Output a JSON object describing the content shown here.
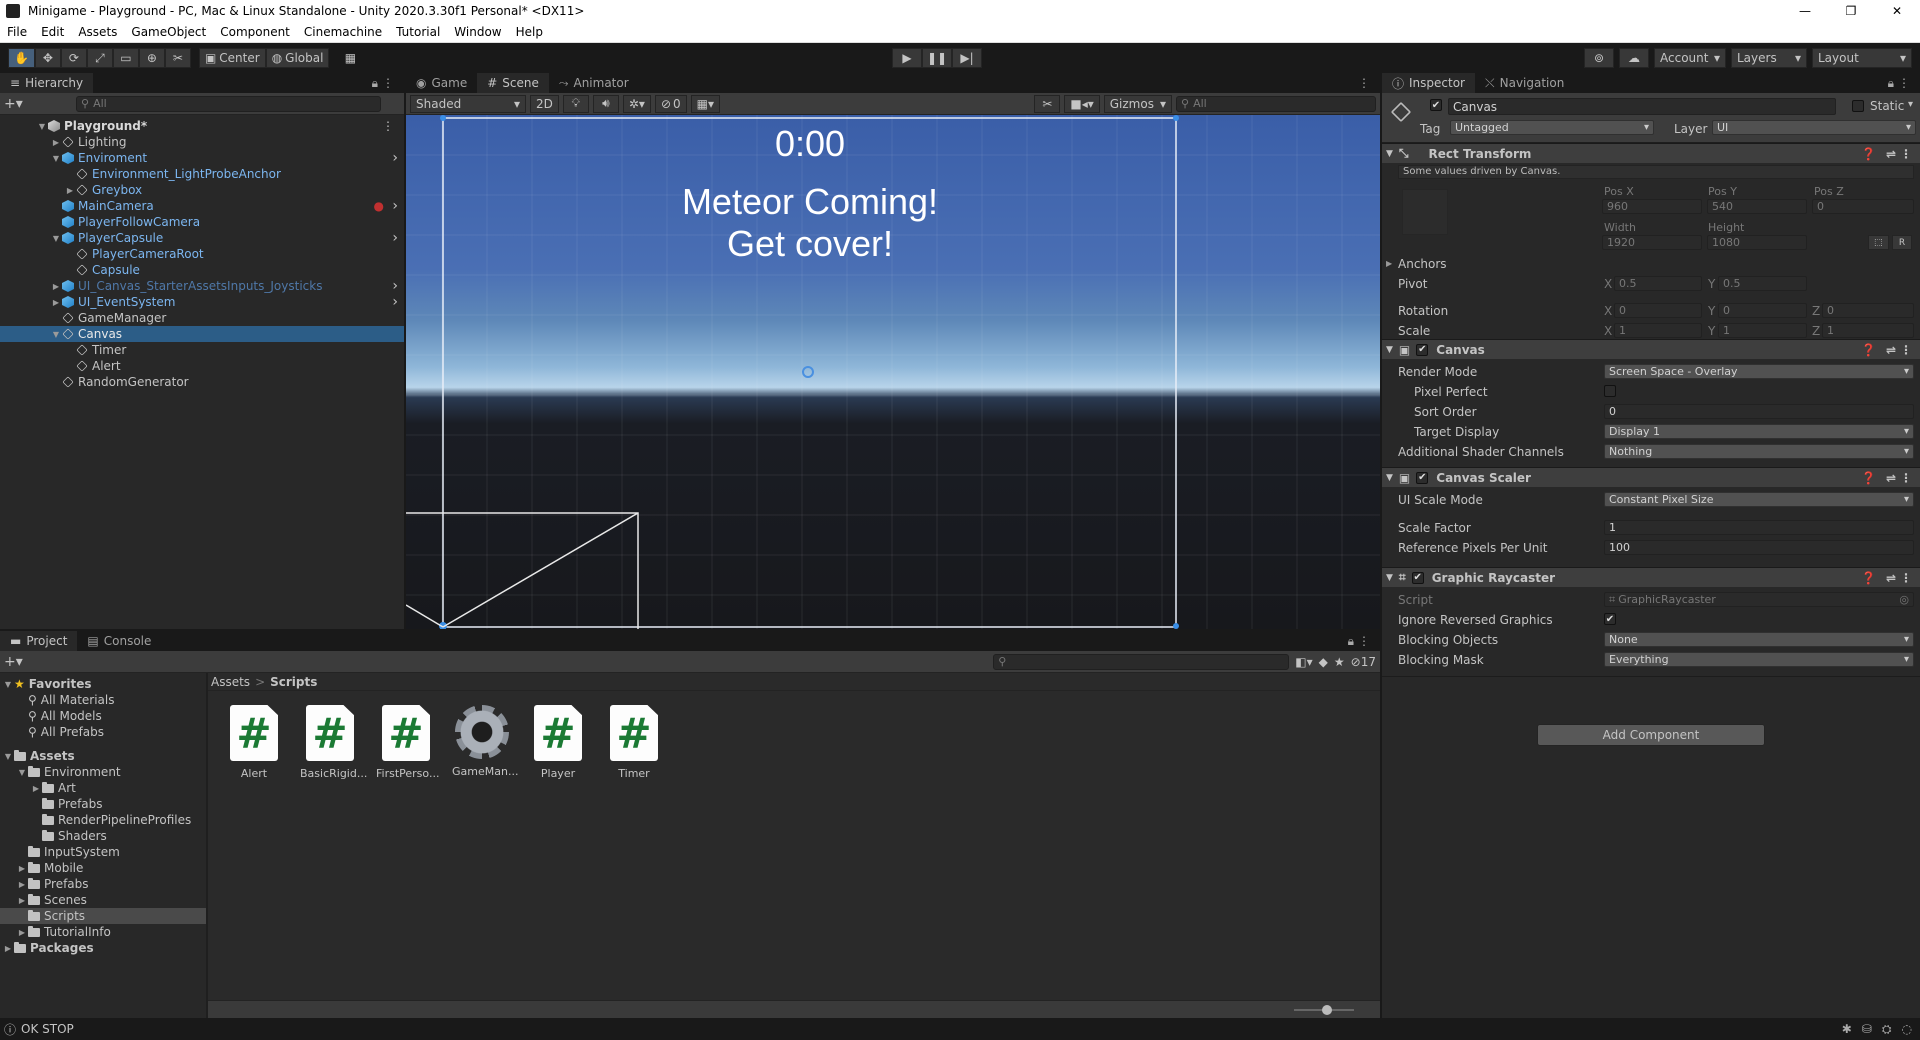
{
  "window": {
    "title": "Minigame - Playground - PC, Mac & Linux Standalone - Unity 2020.3.30f1 Personal* <DX11>",
    "controls": [
      "—",
      "❐",
      "✕"
    ]
  },
  "menu": [
    "File",
    "Edit",
    "Assets",
    "GameObject",
    "Component",
    "Cinemachine",
    "Tutorial",
    "Window",
    "Help"
  ],
  "toolbar": {
    "pivot": "Center",
    "space": "Global",
    "account": "Account",
    "layers": "Layers",
    "layout": "Layout"
  },
  "hierarchy": {
    "tab": "Hierarchy",
    "search_placeholder": "All",
    "items": [
      {
        "label": "Playground*",
        "depth": 0,
        "expand": "▼",
        "icon": "unity-scene-icon",
        "color": "#d8d8d8",
        "bold": true
      },
      {
        "label": "Lighting",
        "depth": 1,
        "expand": "▶",
        "icon": "gameobject-icon",
        "color": "#c4c4c4"
      },
      {
        "label": "Enviroment",
        "depth": 1,
        "expand": "▼",
        "icon": "prefab-icon",
        "color": "#7cb6f0"
      },
      {
        "label": "Environment_LightProbeAnchor",
        "depth": 2,
        "expand": "",
        "icon": "gameobject-icon",
        "color": "#7cb6f0"
      },
      {
        "label": "Greybox",
        "depth": 2,
        "expand": "▶",
        "icon": "gameobject-icon",
        "color": "#7cb6f0"
      },
      {
        "label": "MainCamera",
        "depth": 1,
        "expand": "",
        "icon": "prefab-icon",
        "color": "#7cb6f0"
      },
      {
        "label": "PlayerFollowCamera",
        "depth": 1,
        "expand": "",
        "icon": "prefab-icon",
        "color": "#7cb6f0"
      },
      {
        "label": "PlayerCapsule",
        "depth": 1,
        "expand": "▼",
        "icon": "prefab-icon",
        "color": "#7cb6f0"
      },
      {
        "label": "PlayerCameraRoot",
        "depth": 2,
        "expand": "",
        "icon": "gameobject-icon",
        "color": "#7cb6f0"
      },
      {
        "label": "Capsule",
        "depth": 2,
        "expand": "",
        "icon": "gameobject-icon",
        "color": "#7cb6f0"
      },
      {
        "label": "UI_Canvas_StarterAssetsInputs_Joysticks",
        "depth": 1,
        "expand": "▶",
        "icon": "prefab-icon",
        "color": "#4f78a8"
      },
      {
        "label": "UI_EventSystem",
        "depth": 1,
        "expand": "▶",
        "icon": "prefab-icon",
        "color": "#7cb6f0"
      },
      {
        "label": "GameManager",
        "depth": 1,
        "expand": "",
        "icon": "gameobject-icon",
        "color": "#c4c4c4"
      },
      {
        "label": "Canvas",
        "depth": 1,
        "expand": "▼",
        "icon": "gameobject-icon",
        "color": "#e8e8e8",
        "selected": true
      },
      {
        "label": "Timer",
        "depth": 2,
        "expand": "",
        "icon": "gameobject-icon",
        "color": "#c4c4c4"
      },
      {
        "label": "Alert",
        "depth": 2,
        "expand": "",
        "icon": "gameobject-icon",
        "color": "#c4c4c4"
      },
      {
        "label": "RandomGenerator",
        "depth": 1,
        "expand": "",
        "icon": "gameobject-icon",
        "color": "#c4c4c4"
      }
    ]
  },
  "scene": {
    "tabs": [
      "Game",
      "Scene",
      "Animator"
    ],
    "shading": "Shaded",
    "mode2d": "2D",
    "hidden_count": "0",
    "gizmos": "Gizmos",
    "search_placeholder": "All",
    "timer_text": "0:00",
    "alert_line1": "Meteor Coming!",
    "alert_line2": "Get cover!"
  },
  "inspector": {
    "tabs": [
      "Inspector",
      "Navigation"
    ],
    "object_name": "Canvas",
    "static_label": "Static",
    "tag_label": "Tag",
    "tag_value": "Untagged",
    "layer_label": "Layer",
    "layer_value": "UI",
    "rect_transform": {
      "title": "Rect Transform",
      "note": "Some values driven by Canvas.",
      "posx_label": "Pos X",
      "posx": "960",
      "posy_label": "Pos Y",
      "posy": "540",
      "posz_label": "Pos Z",
      "posz": "0",
      "width_label": "Width",
      "width": "1920",
      "height_label": "Height",
      "height": "1080",
      "anchors": "Anchors",
      "pivot_label": "Pivot",
      "pivot_x": "0.5",
      "pivot_y": "0.5",
      "rotation_label": "Rotation",
      "rot_x": "0",
      "rot_y": "0",
      "rot_z": "0",
      "scale_label": "Scale",
      "scale_x": "1",
      "scale_y": "1",
      "scale_z": "1",
      "axis_x": "X",
      "axis_y": "Y",
      "axis_z": "Z",
      "r_btn": "R"
    },
    "canvas": {
      "title": "Canvas",
      "render_mode_label": "Render Mode",
      "render_mode": "Screen Space - Overlay",
      "pixel_perfect_label": "Pixel Perfect",
      "sort_order_label": "Sort Order",
      "sort_order": "0",
      "target_display_label": "Target Display",
      "target_display": "Display 1",
      "shader_channels_label": "Additional Shader Channels",
      "shader_channels": "Nothing"
    },
    "canvas_scaler": {
      "title": "Canvas Scaler",
      "ui_scale_mode_label": "UI Scale Mode",
      "ui_scale_mode": "Constant Pixel Size",
      "scale_factor_label": "Scale Factor",
      "scale_factor": "1",
      "ref_ppu_label": "Reference Pixels Per Unit",
      "ref_ppu": "100"
    },
    "graphic_raycaster": {
      "title": "Graphic Raycaster",
      "script_label": "Script",
      "script": "GraphicRaycaster",
      "ignore_reversed_label": "Ignore Reversed Graphics",
      "blocking_objects_label": "Blocking Objects",
      "blocking_objects": "None",
      "blocking_mask_label": "Blocking Mask",
      "blocking_mask": "Everything"
    },
    "add_component": "Add Component"
  },
  "project": {
    "tabs": [
      "Project",
      "Console"
    ],
    "hidden_count": "17",
    "breadcrumb_root": "Assets",
    "breadcrumb_sep": ">",
    "breadcrumb_current": "Scripts",
    "tree": [
      {
        "label": "Favorites",
        "depth": 0,
        "expand": "▼",
        "kind": "star",
        "bold": true
      },
      {
        "label": "All Materials",
        "depth": 1,
        "expand": "",
        "kind": "search"
      },
      {
        "label": "All Models",
        "depth": 1,
        "expand": "",
        "kind": "search"
      },
      {
        "label": "All Prefabs",
        "depth": 1,
        "expand": "",
        "kind": "search"
      },
      {
        "label": "",
        "depth": 0,
        "expand": "",
        "kind": "spacer"
      },
      {
        "label": "Assets",
        "depth": 0,
        "expand": "▼",
        "kind": "folder",
        "bold": true
      },
      {
        "label": "Environment",
        "depth": 1,
        "expand": "▼",
        "kind": "folder"
      },
      {
        "label": "Art",
        "depth": 2,
        "expand": "▶",
        "kind": "folder"
      },
      {
        "label": "Prefabs",
        "depth": 2,
        "expand": "",
        "kind": "folder"
      },
      {
        "label": "RenderPipelineProfiles",
        "depth": 2,
        "expand": "",
        "kind": "folder"
      },
      {
        "label": "Shaders",
        "depth": 2,
        "expand": "",
        "kind": "folder"
      },
      {
        "label": "InputSystem",
        "depth": 1,
        "expand": "",
        "kind": "folder"
      },
      {
        "label": "Mobile",
        "depth": 1,
        "expand": "▶",
        "kind": "folder"
      },
      {
        "label": "Prefabs",
        "depth": 1,
        "expand": "▶",
        "kind": "folder"
      },
      {
        "label": "Scenes",
        "depth": 1,
        "expand": "▶",
        "kind": "folder"
      },
      {
        "label": "Scripts",
        "depth": 1,
        "expand": "",
        "kind": "folder",
        "selected": true
      },
      {
        "label": "TutorialInfo",
        "depth": 1,
        "expand": "▶",
        "kind": "folder"
      },
      {
        "label": "Packages",
        "depth": 0,
        "expand": "▶",
        "kind": "folder",
        "bold": true
      }
    ],
    "files": [
      {
        "label": "Alert",
        "icon": "csharp-script-icon"
      },
      {
        "label": "BasicRigid...",
        "icon": "csharp-script-icon"
      },
      {
        "label": "FirstPerso...",
        "icon": "csharp-script-icon"
      },
      {
        "label": "GameMan...",
        "icon": "gear-icon"
      },
      {
        "label": "Player",
        "icon": "csharp-script-icon"
      },
      {
        "label": "Timer",
        "icon": "csharp-script-icon"
      }
    ]
  },
  "status": {
    "text": "OK STOP"
  }
}
